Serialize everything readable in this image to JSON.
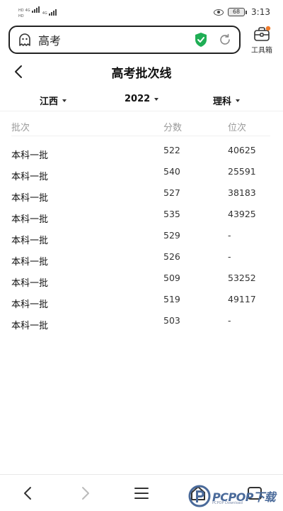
{
  "status": {
    "sig1_tag": "HD",
    "sig2_tag": "HD",
    "net_tag": "4G",
    "net_tag2": "4G",
    "battery": "68",
    "time": "3:13"
  },
  "search": {
    "text": "高考",
    "toolbox_label": "工具箱"
  },
  "page": {
    "title": "高考批次线"
  },
  "filters": {
    "province": "江西",
    "year": "2022",
    "subject": "理科"
  },
  "table": {
    "headers": [
      "批次",
      "分数",
      "位次"
    ],
    "rows": [
      [
        "本科一批",
        "522",
        "40625"
      ],
      [
        "本科一批",
        "540",
        "25591"
      ],
      [
        "本科一批",
        "527",
        "38183"
      ],
      [
        "本科一批",
        "535",
        "43925"
      ],
      [
        "本科一批",
        "529",
        "-"
      ],
      [
        "本科一批",
        "526",
        "-"
      ],
      [
        "本科一批",
        "509",
        "53252"
      ],
      [
        "本科一批",
        "519",
        "49117"
      ],
      [
        "本科一批",
        "503",
        "-"
      ]
    ]
  },
  "watermark": {
    "text": "PCPOP下载",
    "sub": "PCPOP Download"
  },
  "colors": {
    "shield": "#1fae55",
    "badge": "#f07a2a",
    "watermark": "#4a6a9a"
  }
}
